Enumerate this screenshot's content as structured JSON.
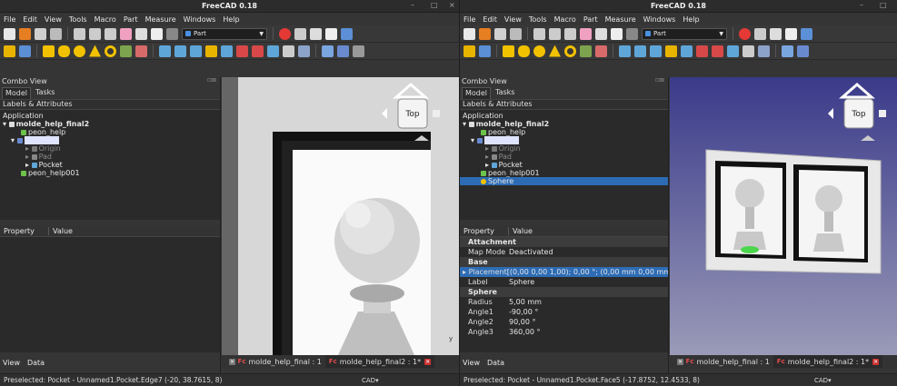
{
  "app_title": "FreeCAD 0.18",
  "menu": [
    "File",
    "Edit",
    "View",
    "Tools",
    "Macro",
    "Part",
    "Measure",
    "Windows",
    "Help"
  ],
  "workbench": "Part",
  "combo_view": {
    "title": "Combo View",
    "tabs": [
      "Model",
      "Tasks"
    ],
    "labels_header": "Labels & Attributes",
    "application": "Application",
    "property_col": "Property",
    "value_col": "Value"
  },
  "tree": {
    "doc": "molde_help_final2",
    "peon": "peon_help",
    "body": "Body",
    "origin": "Origin",
    "pad": "Pad",
    "pocket": "Pocket",
    "peon2": "peon_help001",
    "sphere": "Sphere"
  },
  "properties": {
    "attachment_group": "Attachment",
    "map_mode_k": "Map Mode",
    "map_mode_v": "Deactivated",
    "base_group": "Base",
    "placement_k": "Placement",
    "placement_v": "[(0,00 0,00 1,00); 0,00 °; (0,00 mm  0,00 mm  ...",
    "label_k": "Label",
    "label_v": "Sphere",
    "sphere_group": "Sphere",
    "radius_k": "Radius",
    "radius_v": "5,00 mm",
    "angle1_k": "Angle1",
    "angle1_v": "-90,00 °",
    "angle2_k": "Angle2",
    "angle2_v": "90,00 °",
    "angle3_k": "Angle3",
    "angle3_v": "360,00 °"
  },
  "bottom_tabs": [
    "View",
    "Data"
  ],
  "doc_tabs": [
    "molde_help_final : 1",
    "molde_help_final2 : 1*"
  ],
  "navcube_label": "Top",
  "status_left": "Preselected: Pocket - Unnamed1.Pocket.Edge7 (-20, 38.7615, 8)",
  "status_right": "Preselected: Pocket - Unnamed1.Pocket.Face5 (-17.8752, 12.4533, 8)",
  "cad": "CAD▾",
  "win_controls_left": [
    "–",
    "□",
    "×"
  ],
  "win_controls_right": [
    "–",
    "□"
  ],
  "colors": {
    "accent": "#2d6cb5",
    "record": "#e53935",
    "background_3d": "#d9d9d9",
    "background_3d_right": "#3f3f86"
  }
}
